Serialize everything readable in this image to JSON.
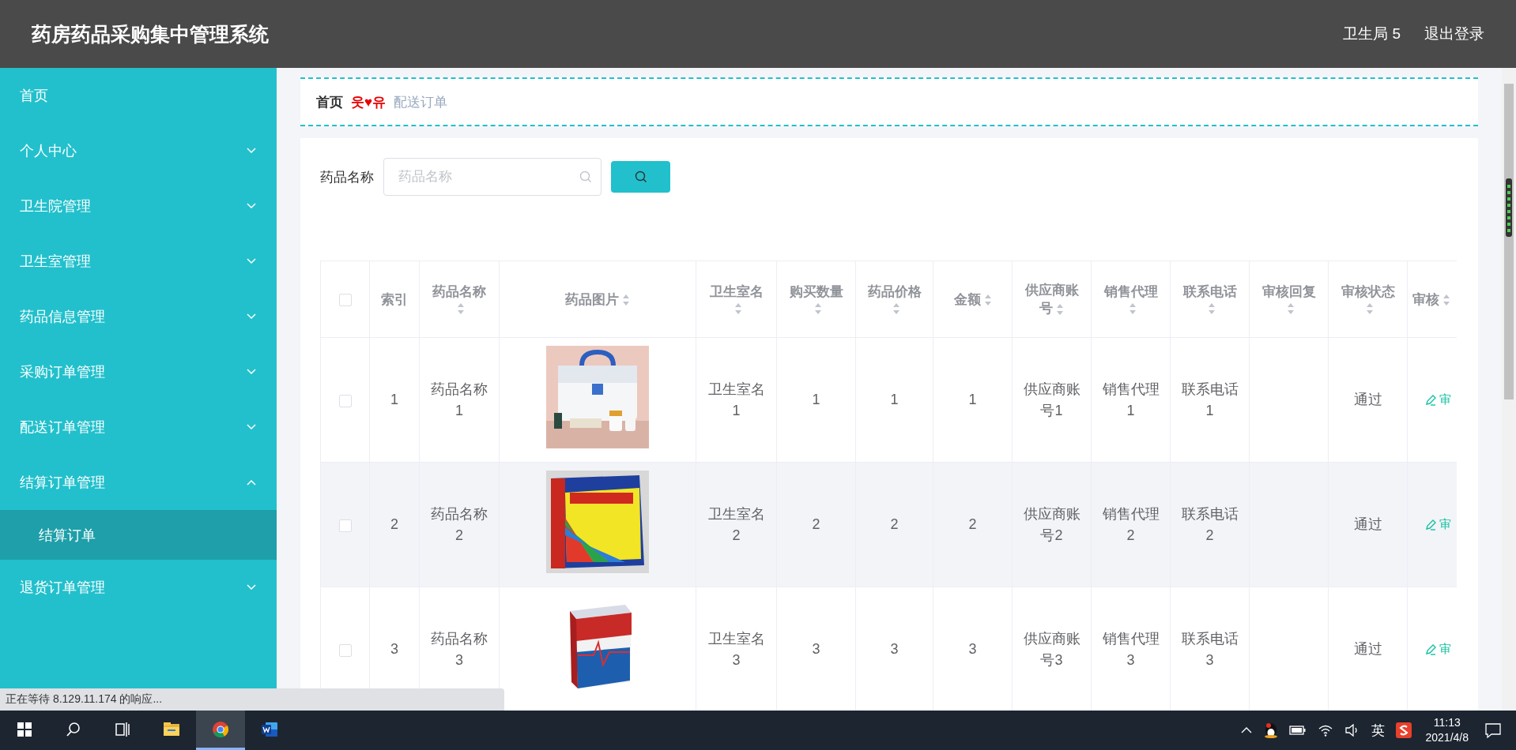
{
  "header": {
    "title": "药房药品采购集中管理系统",
    "user": "卫生局 5",
    "logout": "退出登录"
  },
  "sidebar": {
    "items": [
      {
        "label": "首页",
        "kind": "link"
      },
      {
        "label": "个人中心",
        "kind": "menu",
        "expanded": false
      },
      {
        "label": "卫生院管理",
        "kind": "menu",
        "expanded": false
      },
      {
        "label": "卫生室管理",
        "kind": "menu",
        "expanded": false
      },
      {
        "label": "药品信息管理",
        "kind": "menu",
        "expanded": false
      },
      {
        "label": "采购订单管理",
        "kind": "menu",
        "expanded": false
      },
      {
        "label": "配送订单管理",
        "kind": "menu",
        "expanded": false
      },
      {
        "label": "结算订单管理",
        "kind": "menu",
        "expanded": true,
        "children": [
          {
            "label": "结算订单",
            "selected": true
          }
        ]
      },
      {
        "label": "退货订单管理",
        "kind": "menu",
        "expanded": false
      }
    ]
  },
  "breadcrumb": {
    "home": "首页",
    "separator": "웃♥유",
    "current": "配送订单"
  },
  "search": {
    "label": "药品名称",
    "placeholder": "药品名称"
  },
  "table": {
    "select_all_checked": false,
    "columns": [
      {
        "label": "索引",
        "sortable": false
      },
      {
        "label": "药品名称",
        "sortable": true
      },
      {
        "label": "药品图片",
        "sortable": true
      },
      {
        "label": "卫生室名",
        "sortable": true
      },
      {
        "label": "购买数量",
        "sortable": true
      },
      {
        "label": "药品价格",
        "sortable": true
      },
      {
        "label": "金额",
        "sortable": true
      },
      {
        "label": "供应商账号",
        "sortable": true
      },
      {
        "label": "销售代理",
        "sortable": true
      },
      {
        "label": "联系电话",
        "sortable": true
      },
      {
        "label": "审核回复",
        "sortable": true
      },
      {
        "label": "审核状态",
        "sortable": true
      },
      {
        "label": "审核",
        "sortable": true
      }
    ],
    "rows": [
      {
        "checked": false,
        "hovered": false,
        "index": "1",
        "drug_name": "药品名称1",
        "clinic_name": "卫生室名1",
        "quantity": "1",
        "price": "1",
        "amount": "1",
        "supplier_account": "供应商账号1",
        "sales_agent": "销售代理1",
        "phone": "联系电话1",
        "review_status": "通过",
        "action": "审"
      },
      {
        "checked": false,
        "hovered": true,
        "index": "2",
        "drug_name": "药品名称2",
        "clinic_name": "卫生室名2",
        "quantity": "2",
        "price": "2",
        "amount": "2",
        "supplier_account": "供应商账号2",
        "sales_agent": "销售代理2",
        "phone": "联系电话2",
        "review_status": "通过",
        "action": "审"
      },
      {
        "checked": false,
        "hovered": false,
        "index": "3",
        "drug_name": "药品名称3",
        "clinic_name": "卫生室名3",
        "quantity": "3",
        "price": "3",
        "amount": "3",
        "supplier_account": "供应商账号3",
        "sales_agent": "销售代理3",
        "phone": "联系电话3",
        "review_status": "通过",
        "action": "审"
      }
    ]
  },
  "browser_status": "正在等待 8.129.11.174 的响应...",
  "taskbar": {
    "apps": [
      {
        "kind": "start",
        "active": false
      },
      {
        "kind": "search",
        "active": false
      },
      {
        "kind": "taskview",
        "active": false
      },
      {
        "kind": "explorer",
        "active": false
      },
      {
        "kind": "browser",
        "active": true
      },
      {
        "kind": "word",
        "active": false
      }
    ],
    "input_method": "英",
    "time": "11:13",
    "date": "2021/4/8"
  }
}
